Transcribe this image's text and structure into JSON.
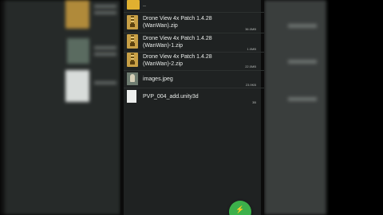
{
  "file_list": {
    "parent_label": "..",
    "items": [
      {
        "name": "Drone View 4x Patch 1.4.28\n(WanWan).zip",
        "size": "36.0MB",
        "icon": "zip-icon"
      },
      {
        "name": "Drone View 4x Patch 1.4.28\n(WanWan)-1.zip",
        "size": "1.0MB",
        "icon": "zip-icon"
      },
      {
        "name": "Drone View 4x Patch 1.4.28\n(WanWan)-2.zip",
        "size": "22.0MB",
        "icon": "zip-icon"
      },
      {
        "name": "images.jpeg",
        "size": "23.9KB",
        "icon": "image-icon"
      },
      {
        "name": "PVP_004_add.unity3d",
        "size": "3B",
        "icon": "file-icon"
      }
    ]
  },
  "fab": {
    "label": "⚡"
  },
  "colors": {
    "fab": "#3cb04a",
    "zip": "#c9a046",
    "background": "#1f2222"
  }
}
